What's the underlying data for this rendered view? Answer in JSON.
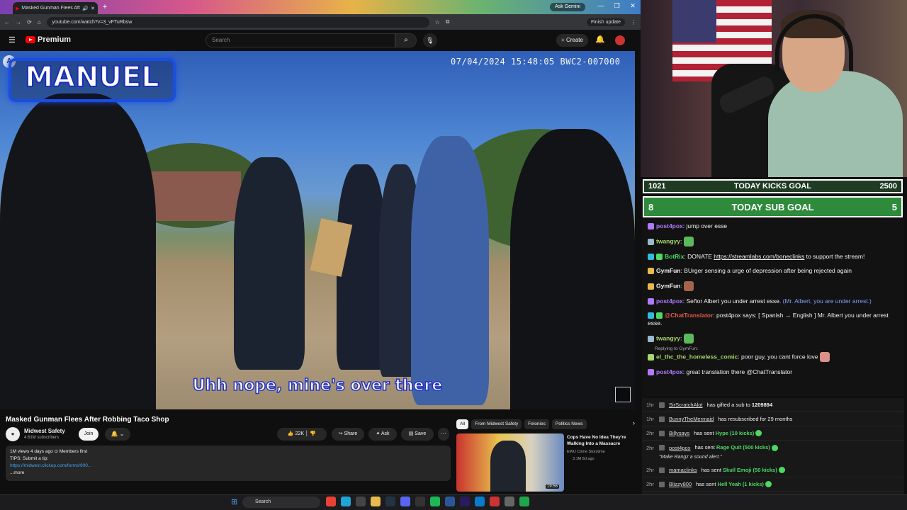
{
  "browser": {
    "tab_title": "Masked Gunman Flees Afte",
    "new_tab": "+",
    "ask_gemini": "Ask Gemini",
    "window_controls": [
      "—",
      "❐",
      "✕"
    ],
    "url": "youtube.com/watch?v=3_vFTuRbsw",
    "finish_update": "Finish update"
  },
  "youtube": {
    "logo": "Premium",
    "search_placeholder": "Search",
    "create_label": "+ Create",
    "video": {
      "timestamp": "07/04/2024 15:48:05 BWC2-007000",
      "name_overlay": "MANUEL",
      "subtitle": "Uhh nope, mine's over there"
    },
    "title": "Masked Gunman Flees After Robbing Taco Shop",
    "channel": {
      "name": "Midwest Safety",
      "subscribers": "4.61M subscribers",
      "join_label": "Join"
    },
    "actions": {
      "likes": "22K",
      "share": "Share",
      "ask": "Ask",
      "save": "Save",
      "more": "⋯"
    },
    "description": {
      "meta": "1M views  4 days ago  ⊙ Members first",
      "line1": "TIPS: Submit a tip:",
      "link": "https://midwest.clickup.com/forms/900...",
      "more": "...more"
    },
    "chips": [
      "All",
      "From Midwest Safety",
      "Felonies",
      "Politics News"
    ],
    "related": {
      "title": "Cops Have No Idea They're Walking Into a Massacre",
      "channel": "EWU Crime Storytime",
      "meta": "3.1M  8d ago",
      "duration": "19:56"
    }
  },
  "stream": {
    "kicks_goal": {
      "current": "1021",
      "label": "TODAY KICKS GOAL",
      "target": "2500"
    },
    "sub_goal": {
      "current": "8",
      "label": "TODAY SUB GOAL",
      "target": "5"
    },
    "chat": [
      {
        "user": "post4pox",
        "color": "#b07aff",
        "text": "jump over esse"
      },
      {
        "user": "twangyy",
        "color": "#a7d86a",
        "text": ""
      },
      {
        "user": "BotRix",
        "color": "#4cd964",
        "text": "DONATE ",
        "link": "https://streamlabs.com/boneclinks",
        "text2": " to support the stream!"
      },
      {
        "user": "GymFun",
        "color": "#ffffff",
        "text": "BUrger sensing a urge of depression after being rejected again"
      },
      {
        "user": "GymFun",
        "color": "#ffffff",
        "text": ""
      },
      {
        "user": "post4pox",
        "color": "#b07aff",
        "text": "Señor Albert you under arrest esse.",
        "translation": "(Mr. Albert, you are under arrest.)"
      },
      {
        "user": "@ChatTranslator",
        "color": "#e05a4a",
        "text": "post4pox says: [ Spanish → English ] Mr. Albert you under arrest esse."
      },
      {
        "user": "twangyy",
        "color": "#a7d86a",
        "text": ""
      },
      {
        "user": "el_thc_the_homeless_comic",
        "color": "#a7d86a",
        "text": "poor guy, you cant force love",
        "reply": "Replying to GymFun:"
      },
      {
        "user": "post4pox",
        "color": "#b07aff",
        "text": "great translation there @ChatTranslator"
      }
    ],
    "events": [
      {
        "time": "1hr",
        "user": "SirScratchAlot",
        "text": "has gifted a sub to ",
        "hl": "1209894",
        "hl_color": "#ffffff"
      },
      {
        "time": "1hr",
        "user": "BunnyTheMermaid",
        "text": "has resubscribed for 29 months",
        "hl": ""
      },
      {
        "time": "2hr",
        "user": "Billysays",
        "text": "has sent ",
        "hl": "Hype (10 kicks)"
      },
      {
        "time": "2hr",
        "user": "post4pox",
        "text": "has sent ",
        "hl": "Rage Quit (500 kicks)",
        "note": "\"Make Rangz a sound alert.\""
      },
      {
        "time": "2hr",
        "user": "mamaclinks",
        "text": "has sent ",
        "hl": "Skull Emoji (50 kicks)"
      },
      {
        "time": "2hr",
        "user": "Blizzy800",
        "text": "has sent ",
        "hl": "Hell Yeah (1 kicks)"
      }
    ]
  },
  "taskbar": {
    "search": "Search"
  }
}
